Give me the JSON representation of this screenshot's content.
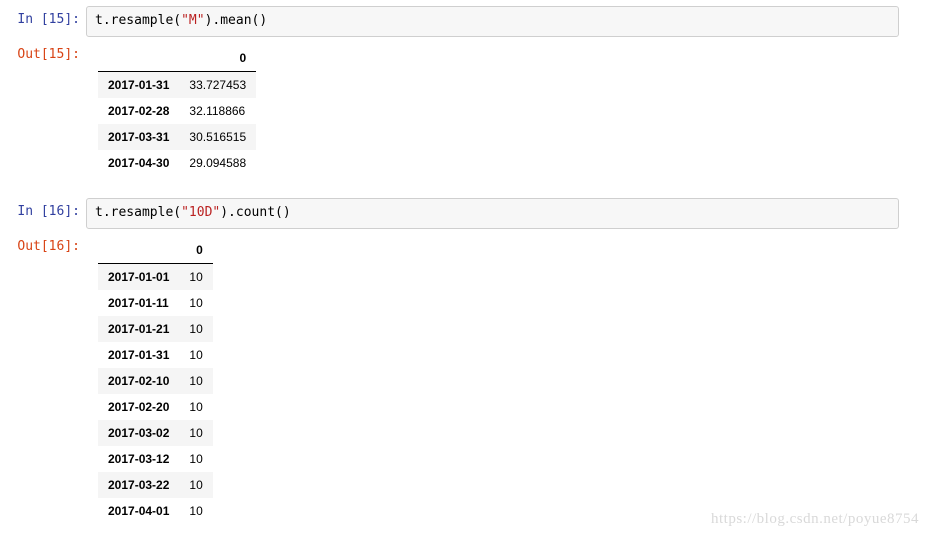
{
  "cells": [
    {
      "in_label": "In [15]:",
      "out_label": "Out[15]:",
      "code_prefix": "t.resample(",
      "code_str": "\"M\"",
      "code_suffix": ").mean()",
      "table": {
        "col_header": "0",
        "rows": [
          {
            "idx": "2017-01-31",
            "val": "33.727453"
          },
          {
            "idx": "2017-02-28",
            "val": "32.118866"
          },
          {
            "idx": "2017-03-31",
            "val": "30.516515"
          },
          {
            "idx": "2017-04-30",
            "val": "29.094588"
          }
        ]
      }
    },
    {
      "in_label": "In [16]:",
      "out_label": "Out[16]:",
      "code_prefix": "t.resample(",
      "code_str": "\"10D\"",
      "code_suffix": ").count()",
      "table": {
        "col_header": "0",
        "rows": [
          {
            "idx": "2017-01-01",
            "val": "10"
          },
          {
            "idx": "2017-01-11",
            "val": "10"
          },
          {
            "idx": "2017-01-21",
            "val": "10"
          },
          {
            "idx": "2017-01-31",
            "val": "10"
          },
          {
            "idx": "2017-02-10",
            "val": "10"
          },
          {
            "idx": "2017-02-20",
            "val": "10"
          },
          {
            "idx": "2017-03-02",
            "val": "10"
          },
          {
            "idx": "2017-03-12",
            "val": "10"
          },
          {
            "idx": "2017-03-22",
            "val": "10"
          },
          {
            "idx": "2017-04-01",
            "val": "10"
          }
        ]
      }
    }
  ],
  "watermark": "https://blog.csdn.net/poyue8754"
}
